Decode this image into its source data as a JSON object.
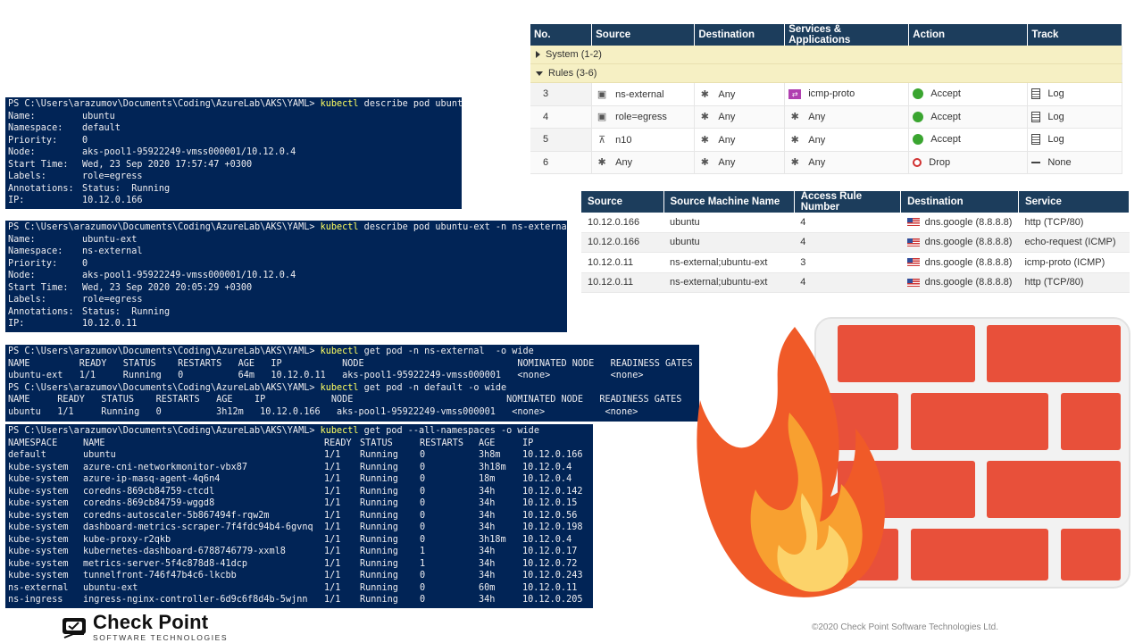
{
  "terminal1": {
    "prompt": "PS C:\\Users\\arazumov\\Documents\\Coding\\AzureLab\\AKS\\YAML> ",
    "command": "kubectl",
    "args": " describe pod ubuntu",
    "rows": [
      [
        "Name:",
        "ubuntu"
      ],
      [
        "Namespace:",
        "default"
      ],
      [
        "Priority:",
        "0"
      ],
      [
        "Node:",
        "aks-pool1-95922249-vmss000001/10.12.0.4"
      ],
      [
        "Start Time:",
        "Wed, 23 Sep 2020 17:57:47 +0300"
      ],
      [
        "Labels:",
        "role=egress"
      ],
      [
        "Annotations:",
        "Status:  Running"
      ],
      [
        "IP:",
        "10.12.0.166"
      ]
    ]
  },
  "terminal2": {
    "prompt": "PS C:\\Users\\arazumov\\Documents\\Coding\\AzureLab\\AKS\\YAML> ",
    "command": "kubectl",
    "args": " describe pod ubuntu-ext -n ns-external",
    "rows": [
      [
        "Name:",
        "ubuntu-ext"
      ],
      [
        "Namespace:",
        "ns-external"
      ],
      [
        "Priority:",
        "0"
      ],
      [
        "Node:",
        "aks-pool1-95922249-vmss000001/10.12.0.4"
      ],
      [
        "Start Time:",
        "Wed, 23 Sep 2020 20:05:29 +0300"
      ],
      [
        "Labels:",
        "role=egress"
      ],
      [
        "Annotations:",
        "Status:  Running"
      ],
      [
        "IP:",
        "10.12.0.11"
      ]
    ]
  },
  "terminal3": {
    "prompt": "PS C:\\Users\\arazumov\\Documents\\Coding\\AzureLab\\AKS\\YAML> ",
    "command1": "kubectl",
    "args1": " get pod -n ns-external  -o wide",
    "header1": "NAME         READY   STATUS    RESTARTS   AGE   IP           NODE                            NOMINATED NODE   READINESS GATES",
    "row1": "ubuntu-ext   1/1     Running   0          64m   10.12.0.11   aks-pool1-95922249-vmss000001   <none>           <none>",
    "command2": "kubectl",
    "args2": " get pod -n default -o wide",
    "header2": "NAME     READY   STATUS    RESTARTS   AGE    IP            NODE                            NOMINATED NODE   READINESS GATES",
    "row2": "ubuntu   1/1     Running   0          3h12m   10.12.0.166   aks-pool1-95922249-vmss000001   <none>           <none>"
  },
  "terminal4": {
    "prompt": "PS C:\\Users\\arazumov\\Documents\\Coding\\AzureLab\\AKS\\YAML> ",
    "command": "kubectl",
    "args": " get pod --all-namespaces -o wide",
    "columns": [
      "NAMESPACE",
      "NAME",
      "READY",
      "STATUS",
      "RESTARTS",
      "AGE",
      "IP"
    ],
    "rows": [
      [
        "default",
        "ubuntu",
        "1/1",
        "Running",
        "0",
        "3h8m",
        "10.12.0.166"
      ],
      [
        "kube-system",
        "azure-cni-networkmonitor-vbx87",
        "1/1",
        "Running",
        "0",
        "3h18m",
        "10.12.0.4"
      ],
      [
        "kube-system",
        "azure-ip-masq-agent-4q6n4",
        "1/1",
        "Running",
        "0",
        "18m",
        "10.12.0.4"
      ],
      [
        "kube-system",
        "coredns-869cb84759-ctcdl",
        "1/1",
        "Running",
        "0",
        "34h",
        "10.12.0.142"
      ],
      [
        "kube-system",
        "coredns-869cb84759-wggd8",
        "1/1",
        "Running",
        "0",
        "34h",
        "10.12.0.15"
      ],
      [
        "kube-system",
        "coredns-autoscaler-5b867494f-rqw2m",
        "1/1",
        "Running",
        "0",
        "34h",
        "10.12.0.56"
      ],
      [
        "kube-system",
        "dashboard-metrics-scraper-7f4fdc94b4-6gvnq",
        "1/1",
        "Running",
        "0",
        "34h",
        "10.12.0.198"
      ],
      [
        "kube-system",
        "kube-proxy-r2qkb",
        "1/1",
        "Running",
        "0",
        "3h18m",
        "10.12.0.4"
      ],
      [
        "kube-system",
        "kubernetes-dashboard-6788746779-xxml8",
        "1/1",
        "Running",
        "1",
        "34h",
        "10.12.0.17"
      ],
      [
        "kube-system",
        "metrics-server-5f4c878d8-41dcp",
        "1/1",
        "Running",
        "1",
        "34h",
        "10.12.0.72"
      ],
      [
        "kube-system",
        "tunnelfront-746f47b4c6-lkcbb",
        "1/1",
        "Running",
        "0",
        "34h",
        "10.12.0.243"
      ],
      [
        "ns-external",
        "ubuntu-ext",
        "1/1",
        "Running",
        "0",
        "60m",
        "10.12.0.11"
      ],
      [
        "ns-ingress",
        "ingress-nginx-controller-6d9c6f8d4b-5wjnn",
        "1/1",
        "Running",
        "0",
        "34h",
        "10.12.0.205"
      ]
    ]
  },
  "rulebase": {
    "columns": [
      "No.",
      "Source",
      "Destination",
      "Services & Applications",
      "Action",
      "Track"
    ],
    "section_system": "System (1-2)",
    "section_rules": "Rules (3-6)",
    "rows": [
      {
        "no": "3",
        "source": "ns-external",
        "source_icon": "network-object-icon",
        "destination": "Any",
        "service": "icmp-proto",
        "service_icon": "icmp-service-icon",
        "action": "Accept",
        "track": "Log"
      },
      {
        "no": "4",
        "source": "role=egress",
        "source_icon": "network-object-icon",
        "destination": "Any",
        "service": "Any",
        "service_icon": "any-icon",
        "action": "Accept",
        "track": "Log"
      },
      {
        "no": "5",
        "source": "n10",
        "source_icon": "network-icon",
        "destination": "Any",
        "service": "Any",
        "service_icon": "any-icon",
        "action": "Accept",
        "track": "Log"
      },
      {
        "no": "6",
        "source": "Any",
        "source_icon": "any-icon",
        "destination": "Any",
        "service": "Any",
        "service_icon": "any-icon",
        "action": "Drop",
        "track": "None"
      }
    ],
    "colors": {
      "header": "#1c3d5c",
      "section": "#f6f0c4",
      "accept": "#3aa530",
      "drop": "#d03030"
    }
  },
  "logs": {
    "columns": [
      "Source",
      "Source Machine Name",
      "Access Rule Number",
      "Destination",
      "Service"
    ],
    "rows": [
      [
        "10.12.0.166",
        "ubuntu",
        "4",
        "dns.google (8.8.8.8)",
        "http (TCP/80)"
      ],
      [
        "10.12.0.166",
        "ubuntu",
        "4",
        "dns.google (8.8.8.8)",
        "echo-request (ICMP)"
      ],
      [
        "10.12.0.11",
        "ns-external;ubuntu-ext",
        "3",
        "dns.google (8.8.8.8)",
        "icmp-proto (ICMP)"
      ],
      [
        "10.12.0.11",
        "ns-external;ubuntu-ext",
        "4",
        "dns.google (8.8.8.8)",
        "http (TCP/80)"
      ]
    ]
  },
  "footer": {
    "brand": "Check Point",
    "tagline": "SOFTWARE TECHNOLOGIES",
    "copyright": "©2020 Check Point Software Technologies Ltd."
  },
  "graphic": {
    "name": "firewall-icon",
    "brick_color": "#e8503a",
    "flame_colors": [
      "#f05a28",
      "#f8a030",
      "#fcd36a"
    ]
  }
}
